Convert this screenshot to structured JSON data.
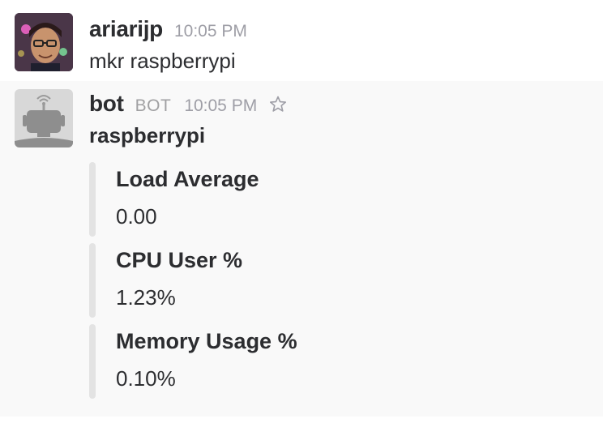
{
  "messages": {
    "user": {
      "username": "ariarijp",
      "timestamp": "10:05 PM",
      "text": "mkr raspberrypi",
      "avatar_icon": "user-avatar"
    },
    "bot": {
      "username": "bot",
      "badge": "BOT",
      "timestamp": "10:05 PM",
      "star_icon": "star-outline-icon",
      "avatar_icon": "robot-avatar",
      "title": "raspberrypi",
      "fields": [
        {
          "title": "Load Average",
          "value": "0.00"
        },
        {
          "title": "CPU User %",
          "value": "1.23%"
        },
        {
          "title": "Memory Usage %",
          "value": "0.10%"
        }
      ]
    }
  },
  "colors": {
    "text": "#2c2d30",
    "muted": "#9e9ea6",
    "bot_background": "#f9f9f9",
    "attachment_bar": "#e3e3e3"
  }
}
